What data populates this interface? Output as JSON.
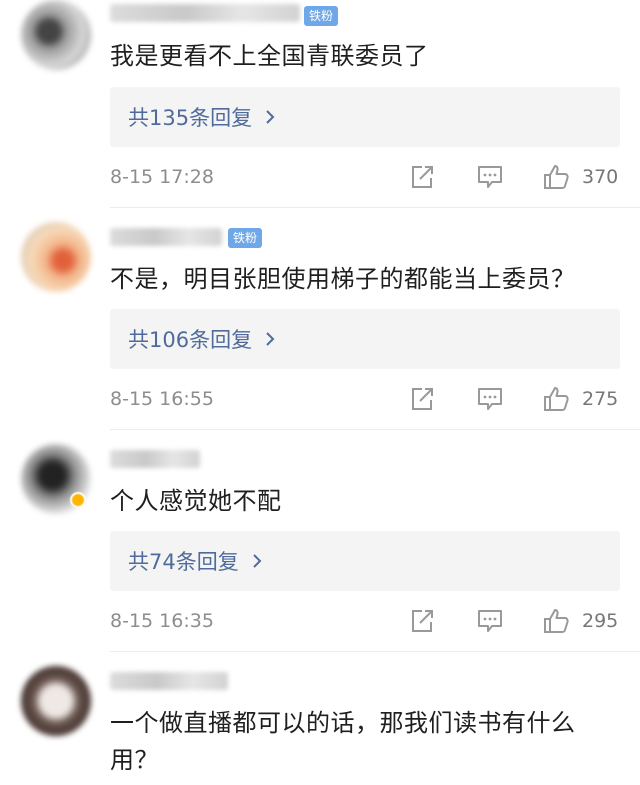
{
  "comments": [
    {
      "badge": "铁粉",
      "text": "我是更看不上全国青联委员了",
      "reply": "共135条回复",
      "time": "8-15 17:28",
      "likes": "370"
    },
    {
      "badge": "铁粉",
      "text": "不是，明目张胆使用梯子的都能当上委员？",
      "reply": "共106条回复",
      "time": "8-15 16:55",
      "likes": "275"
    },
    {
      "badge": "",
      "text": "个人感觉她不配",
      "reply": "共74条回复",
      "time": "8-15 16:35",
      "likes": "295"
    },
    {
      "badge": "",
      "text": "一个做直播都可以的话，那我们读书有什么用？",
      "reply": "",
      "time": "",
      "likes": ""
    }
  ],
  "colors": {
    "reply_link": "#506b9b",
    "fan_badge": "#6fa8e8",
    "meta_text": "#8d8d8d"
  },
  "icons": {
    "share": "share-icon",
    "comment": "comment-icon",
    "like": "thumbs-up-icon",
    "chevron": "chevron-right-icon"
  }
}
